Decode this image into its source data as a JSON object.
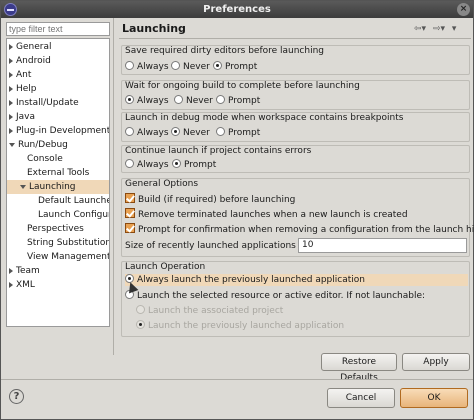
{
  "window": {
    "title": "Preferences",
    "close_glyph": "×"
  },
  "filter": {
    "placeholder": "type filter text"
  },
  "tree": {
    "items": [
      {
        "label": "General",
        "expander": "right",
        "selected": false
      },
      {
        "label": "Android",
        "expander": "right",
        "selected": false
      },
      {
        "label": "Ant",
        "expander": "right",
        "selected": false
      },
      {
        "label": "Help",
        "expander": "right",
        "selected": false
      },
      {
        "label": "Install/Update",
        "expander": "right",
        "selected": false
      },
      {
        "label": "Java",
        "expander": "right",
        "selected": false
      },
      {
        "label": "Plug-in Development",
        "expander": "right",
        "selected": false
      },
      {
        "label": "Run/Debug",
        "expander": "down",
        "selected": false
      },
      {
        "label": "Console",
        "expander": "none",
        "selected": false
      },
      {
        "label": "External Tools",
        "expander": "none",
        "selected": false
      },
      {
        "label": "Launching",
        "expander": "down",
        "selected": true
      },
      {
        "label": "Default Launche",
        "expander": "none",
        "selected": false
      },
      {
        "label": "Launch Configur",
        "expander": "none",
        "selected": false
      },
      {
        "label": "Perspectives",
        "expander": "none",
        "selected": false
      },
      {
        "label": "String Substitution",
        "expander": "none",
        "selected": false
      },
      {
        "label": "View Management",
        "expander": "none",
        "selected": false
      },
      {
        "label": "Team",
        "expander": "right",
        "selected": false
      },
      {
        "label": "XML",
        "expander": "right",
        "selected": false
      }
    ]
  },
  "page": {
    "title": "Launching",
    "nav_back": "⇦▾",
    "nav_forward": "⇨▾",
    "menu": "▾"
  },
  "groups": {
    "save": {
      "label": "Save required dirty editors before launching",
      "options": [
        "Always",
        "Never",
        "Prompt"
      ],
      "selected": "Prompt"
    },
    "wait": {
      "label": "Wait for ongoing build to complete before launching",
      "options": [
        "Always",
        "Never",
        "Prompt"
      ],
      "selected": "Always"
    },
    "debug": {
      "label": "Launch in debug mode when workspace contains breakpoints",
      "options": [
        "Always",
        "Never",
        "Prompt"
      ],
      "selected": "Never"
    },
    "errors": {
      "label": "Continue launch if project contains errors",
      "options": [
        "Always",
        "Prompt"
      ],
      "selected": "Prompt"
    },
    "general": {
      "label": "General Options",
      "checks": [
        {
          "label": "Build (if required) before launching",
          "checked": true
        },
        {
          "label": "Remove terminated launches when a new launch is created",
          "checked": true
        },
        {
          "label": "Prompt for confirmation when removing a configuration from the launch history",
          "checked": true
        }
      ],
      "size_label": "Size of recently launched applications list:",
      "size_value": "10"
    },
    "operation": {
      "label": "Launch Operation",
      "always": "Always launch the previously launched application",
      "selected_resource": "Launch the selected resource or active editor. If not launchable:",
      "sub_associated": "Launch the associated project",
      "sub_previous": "Launch the previously launched application"
    }
  },
  "buttons": {
    "restore": "Restore Defaults",
    "apply": "Apply",
    "cancel": "Cancel",
    "ok": "OK",
    "help": "?"
  }
}
